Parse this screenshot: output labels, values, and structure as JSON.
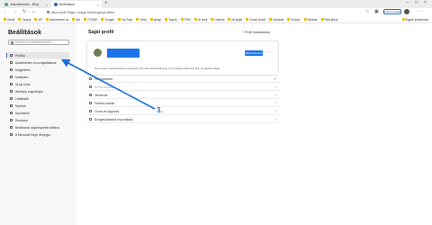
{
  "tabs": [
    {
      "label": "Jelszókezelés - Bing"
    },
    {
      "label": "Beállítások"
    }
  ],
  "address": "Microsoft Edge  |  edge://settings/profiles",
  "zoom_button": "Szinkronizálás",
  "favorites": [
    "Gmail",
    "Csaput",
    "AR",
    "Adeventurel.hu",
    "Akt",
    "TV/SDK",
    "Google",
    "YouTube",
    "Hírek",
    "slelap",
    "Tippek",
    "TRIX",
    "Ár ilvelt",
    "Hunriza",
    "Mi bejelt",
    "Groep Sebel",
    "Sáratolá",
    "Groep1",
    "Infoknik",
    "Hely jékok"
  ],
  "favorites_other": "Egyéb kedvencek",
  "sidebar": {
    "title": "Beállítások",
    "search_placeholder": "Keresés a beállítások között",
    "items": [
      {
        "label": "Profilok"
      },
      {
        "label": "Adatvédelem és szolgáltatások"
      },
      {
        "label": "Megjelenés"
      },
      {
        "label": "Indításkor"
      },
      {
        "label": "Új lap oldal"
      },
      {
        "label": "Webhely-engedélyek"
      },
      {
        "label": "Letöltések"
      },
      {
        "label": "Nyelvek"
      },
      {
        "label": "Nyomtatók"
      },
      {
        "label": "Rendszer"
      },
      {
        "label": "Beállítások alaphelyzetbe állítása"
      },
      {
        "label": "A Microsoft Edge névjegye"
      }
    ]
  },
  "main": {
    "title": "Saját profil",
    "add_profile": "+  Profil hozzáadása",
    "sync_button": "Bejelentkezés",
    "card_text": "Nem kezem bondomdozka a bőngesőt, beni információt fiók hegy az Ön fiókja a Microsoft fiók, és gépelje Fölgle.",
    "rows": [
      {
        "label": "Fiók kezelése"
      },
      {
        "label": "Szinkronizálás"
      },
      {
        "label": "Jelszavak"
      },
      {
        "label": "Fizetési adatok"
      },
      {
        "label": "Címek és egyebek"
      },
      {
        "label": "Böngészőadatok importálása"
      }
    ]
  },
  "annotation": {
    "number": "3."
  }
}
